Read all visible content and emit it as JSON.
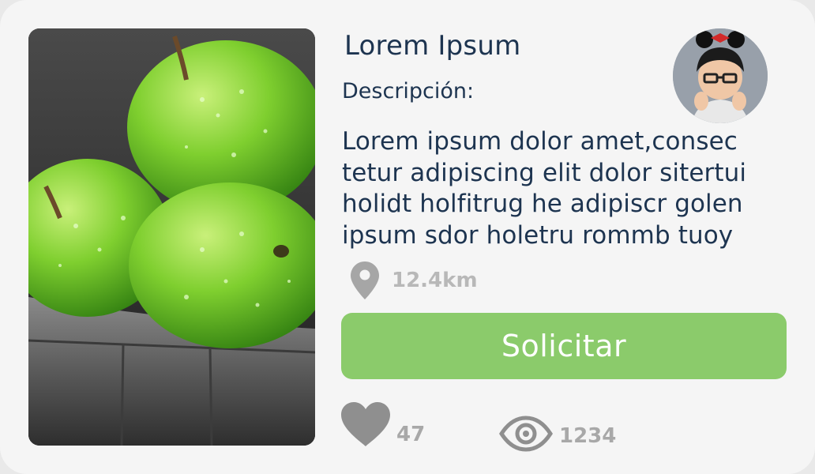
{
  "card": {
    "title": "Lorem Ipsum",
    "description_label": "Descripción:",
    "description_lines": [
      "Lorem ipsum dolor amet,consec",
      "tetur adipiscing elit dolor sitertui",
      "holidt holfitrug he adipiscr golen",
      "ipsum sdor holetru rommb tuoy"
    ],
    "distance": "12.4km",
    "action_label": "Solicitar",
    "likes": "47",
    "views": "1234"
  },
  "icons": {
    "location": "map-pin-icon",
    "likes": "heart-icon",
    "views": "eye-icon"
  },
  "colors": {
    "text": "#1d3450",
    "button": "#8bcb6b",
    "muted": "#a8a8a8"
  }
}
